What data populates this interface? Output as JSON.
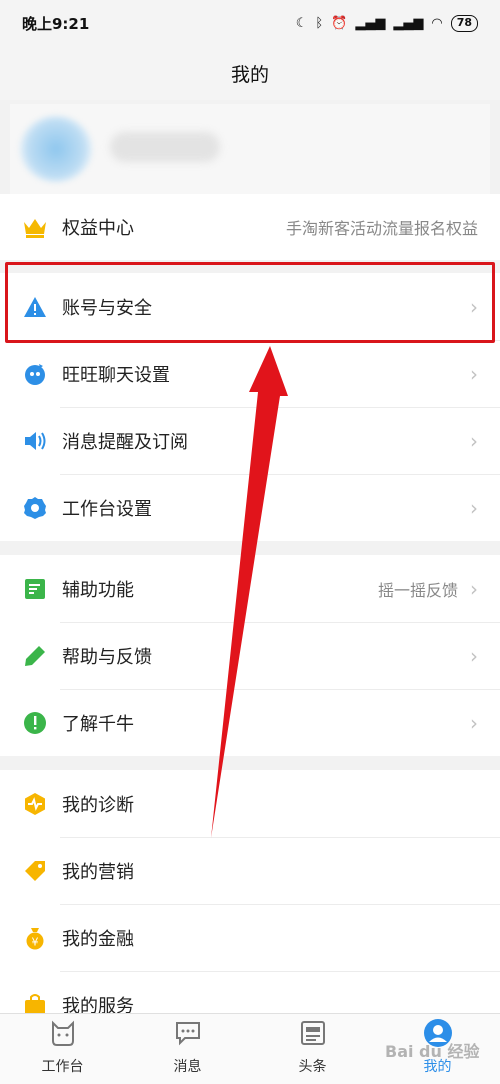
{
  "status_bar": {
    "time": "晚上9:21",
    "battery": "78"
  },
  "nav": {
    "title": "我的"
  },
  "benefit": {
    "label": "权益中心",
    "detail": "手淘新客活动流量报名权益"
  },
  "group1": [
    {
      "label": "账号与安全",
      "icon": "warning-icon"
    },
    {
      "label": "旺旺聊天设置",
      "icon": "wangwang-icon"
    },
    {
      "label": "消息提醒及订阅",
      "icon": "speaker-icon"
    },
    {
      "label": "工作台设置",
      "icon": "gear-icon"
    }
  ],
  "group2": [
    {
      "label": "辅助功能",
      "detail": "摇一摇反馈",
      "icon": "list-icon"
    },
    {
      "label": "帮助与反馈",
      "icon": "pencil-icon"
    },
    {
      "label": "了解千牛",
      "icon": "info-icon"
    }
  ],
  "group3": [
    {
      "label": "我的诊断",
      "icon": "diagnosis-icon"
    },
    {
      "label": "我的营销",
      "icon": "tag-icon"
    },
    {
      "label": "我的金融",
      "icon": "money-bag-icon"
    },
    {
      "label": "我的服务",
      "icon": "bag-icon"
    }
  ],
  "tabs": [
    {
      "label": "工作台",
      "icon": "workbench-icon"
    },
    {
      "label": "消息",
      "icon": "message-icon"
    },
    {
      "label": "头条",
      "icon": "news-icon"
    },
    {
      "label": "我的",
      "icon": "user-icon"
    }
  ],
  "colors": {
    "accent": "#2c8ee8",
    "highlight": "#d9151b"
  }
}
